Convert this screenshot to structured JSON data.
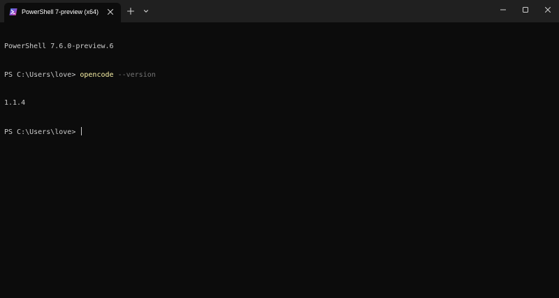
{
  "tab": {
    "title": "PowerShell 7-preview (x64)",
    "icon": "powershell-icon"
  },
  "toolbar": {
    "new_tab_icon": "plus-icon",
    "dropdown_icon": "chevron-down-icon"
  },
  "window_controls": {
    "minimize_icon": "minimize-icon",
    "maximize_icon": "maximize-icon",
    "close_icon": "close-icon"
  },
  "terminal": {
    "banner": "PowerShell 7.6.0-preview.6",
    "prompt1": "PS C:\\Users\\love> ",
    "command": "opencode",
    "command_param": " --version",
    "output": "1.1.4",
    "prompt2": "PS C:\\Users\\love> "
  },
  "colors": {
    "background": "#0c0c0c",
    "titlebar": "#202020",
    "text": "#cccccc",
    "command": "#f9f1a5",
    "parameter": "#767676"
  }
}
